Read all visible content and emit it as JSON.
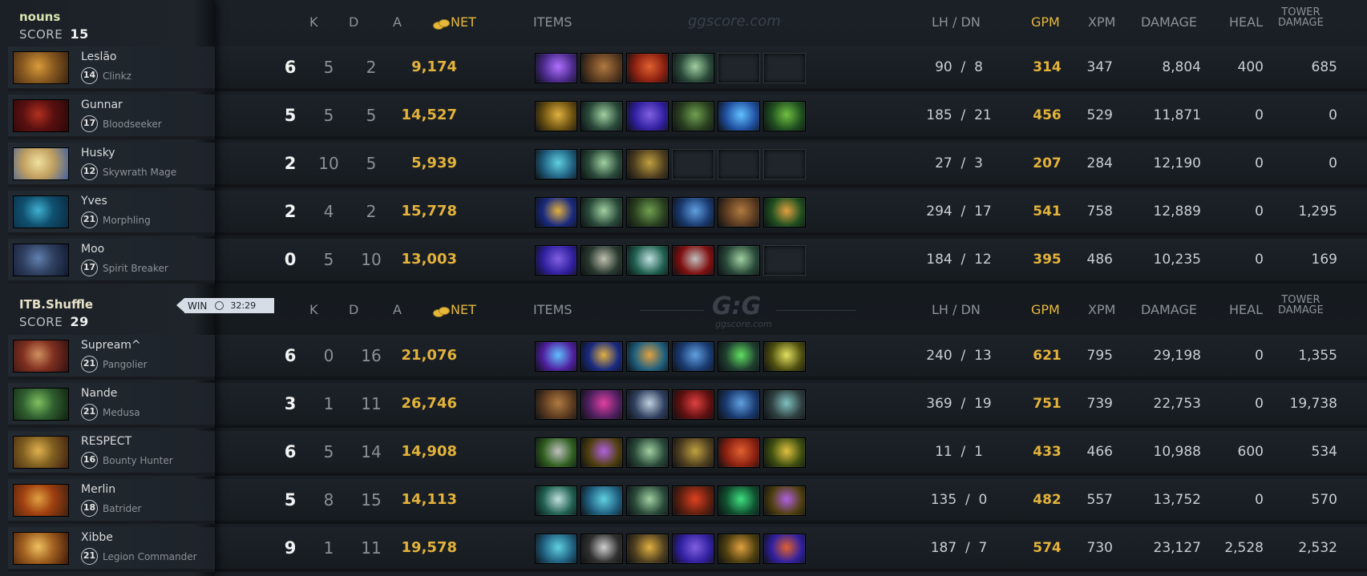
{
  "watermark": "ggscore.com",
  "logo": "G:G",
  "logo_sub": "ggscore.com",
  "headers": {
    "k": "K",
    "d": "D",
    "a": "A",
    "net": "NET",
    "items": "ITEMS",
    "lh_dn": "LH  /  DN",
    "gpm": "GPM",
    "xpm": "XPM",
    "damage": "DAMAGE",
    "heal": "HEAL",
    "tower_1": "TOWER",
    "tower_2": "DAMAGE"
  },
  "result": {
    "label": "WIN",
    "duration": "32:29"
  },
  "teams": [
    {
      "name": "nouns",
      "score_label": "SCORE",
      "score": "15",
      "players": [
        {
          "name": "Leslão",
          "level": "14",
          "hero": "Clinkz",
          "k": "6",
          "d": "5",
          "a": "2",
          "net": "9,174",
          "lh": "90",
          "dn": "8",
          "gpm": "314",
          "xpm": "347",
          "damage": "8,804",
          "heal": "400",
          "tower": "685",
          "portrait": [
            "#8a5a20",
            "#d89b3a",
            "#3a2410"
          ],
          "items": [
            [
              "#4a2a8a",
              "#b070ff"
            ],
            [
              "#5a3a20",
              "#b07a40"
            ],
            [
              "#8a2010",
              "#e06030"
            ],
            [
              "#2a4a3a",
              "#a0d0a0"
            ],
            null,
            null
          ]
        },
        {
          "name": "Gunnar",
          "level": "17",
          "hero": "Bloodseeker",
          "k": "5",
          "d": "5",
          "a": "5",
          "net": "14,527",
          "lh": "185",
          "dn": "21",
          "gpm": "456",
          "xpm": "529",
          "damage": "11,871",
          "heal": "0",
          "tower": "0",
          "portrait": [
            "#5a1010",
            "#b03020",
            "#2a0808"
          ],
          "items": [
            [
              "#6a5010",
              "#e0b040"
            ],
            [
              "#2a4a3a",
              "#a0d0a0"
            ],
            [
              "#3020a0",
              "#8060e0"
            ],
            [
              "#2a4020",
              "#70a050"
            ],
            [
              "#2050a0",
              "#60c0ff"
            ],
            [
              "#205020",
              "#70c040"
            ]
          ]
        },
        {
          "name": "Husky",
          "level": "12",
          "hero": "Skywrath Mage",
          "k": "2",
          "d": "10",
          "a": "5",
          "net": "5,939",
          "lh": "27",
          "dn": "3",
          "gpm": "207",
          "xpm": "284",
          "damage": "12,190",
          "heal": "0",
          "tower": "0",
          "portrait": [
            "#c0a060",
            "#f0e0a0",
            "#4060a0"
          ],
          "items": [
            [
              "#206080",
              "#60d0e0"
            ],
            [
              "#2a4a3a",
              "#a0d0a0"
            ],
            [
              "#504020",
              "#c0a040"
            ],
            null,
            null,
            null
          ]
        },
        {
          "name": "Yves",
          "level": "21",
          "hero": "Morphling",
          "k": "2",
          "d": "4",
          "a": "2",
          "net": "15,778",
          "lh": "294",
          "dn": "17",
          "gpm": "541",
          "xpm": "758",
          "damage": "12,889",
          "heal": "0",
          "tower": "1,295",
          "portrait": [
            "#105070",
            "#40b0d0",
            "#0a2a40"
          ],
          "items": [
            [
              "#1a2a80",
              "#e0b040"
            ],
            [
              "#2a4a3a",
              "#a0d0a0"
            ],
            [
              "#2a4020",
              "#70a050"
            ],
            [
              "#1a3a70",
              "#60a0e0"
            ],
            [
              "#5a3a20",
              "#b07a40"
            ],
            [
              "#205020",
              "#e0a040"
            ]
          ]
        },
        {
          "name": "Moo",
          "level": "17",
          "hero": "Spirit Breaker",
          "k": "0",
          "d": "5",
          "a": "10",
          "net": "13,003",
          "lh": "184",
          "dn": "12",
          "gpm": "395",
          "xpm": "486",
          "damage": "10,235",
          "heal": "0",
          "tower": "169",
          "portrait": [
            "#304060",
            "#6080b0",
            "#101830"
          ],
          "items": [
            [
              "#3020a0",
              "#8060e0"
            ],
            [
              "#2a3a30",
              "#c0c0b0"
            ],
            [
              "#206050",
              "#c0e0e0"
            ],
            [
              "#801010",
              "#c0c0c0"
            ],
            [
              "#2a4a3a",
              "#a0d0a0"
            ],
            null
          ]
        }
      ]
    },
    {
      "name": "ITB.Shuffle",
      "score_label": "SCORE",
      "score": "29",
      "players": [
        {
          "name": "Supream^",
          "level": "21",
          "hero": "Pangolier",
          "k": "6",
          "d": "0",
          "a": "16",
          "net": "21,076",
          "lh": "240",
          "dn": "13",
          "gpm": "621",
          "xpm": "795",
          "damage": "29,198",
          "heal": "0",
          "tower": "1,355",
          "portrait": [
            "#803020",
            "#d09060",
            "#301010"
          ],
          "items": [
            [
              "#5020a0",
              "#60c0ff"
            ],
            [
              "#1a2a80",
              "#e0b040"
            ],
            [
              "#206080",
              "#e0a040"
            ],
            [
              "#1a3a70",
              "#60a0e0"
            ],
            [
              "#204030",
              "#60e060"
            ],
            [
              "#505010",
              "#e0e060"
            ]
          ]
        },
        {
          "name": "Nande",
          "level": "21",
          "hero": "Medusa",
          "k": "3",
          "d": "1",
          "a": "11",
          "net": "26,746",
          "lh": "369",
          "dn": "19",
          "gpm": "751",
          "xpm": "739",
          "damage": "22,753",
          "heal": "0",
          "tower": "19,738",
          "portrait": [
            "#306030",
            "#80c060",
            "#102010"
          ],
          "items": [
            [
              "#5a3a20",
              "#b07a40"
            ],
            [
              "#502060",
              "#e040a0"
            ],
            [
              "#304060",
              "#c0d0e0"
            ],
            [
              "#601010",
              "#e04040"
            ],
            [
              "#1a3a70",
              "#60a0e0"
            ],
            [
              "#304040",
              "#80c0c0"
            ]
          ]
        },
        {
          "name": "RESPECT",
          "level": "16",
          "hero": "Bounty Hunter",
          "k": "6",
          "d": "5",
          "a": "14",
          "net": "14,908",
          "lh": "11",
          "dn": "1",
          "gpm": "433",
          "xpm": "466",
          "damage": "10,988",
          "heal": "600",
          "tower": "534",
          "portrait": [
            "#806020",
            "#e0b050",
            "#402010"
          ],
          "items": [
            [
              "#306020",
              "#c0c0c0"
            ],
            [
              "#504010",
              "#b060e0"
            ],
            [
              "#2a4a3a",
              "#a0d0a0"
            ],
            [
              "#504020",
              "#c0a040"
            ],
            [
              "#8a2010",
              "#e06030"
            ],
            [
              "#405010",
              "#e0c040"
            ]
          ]
        },
        {
          "name": "Merlin",
          "level": "18",
          "hero": "Batrider",
          "k": "5",
          "d": "8",
          "a": "15",
          "net": "14,113",
          "lh": "135",
          "dn": "0",
          "gpm": "482",
          "xpm": "557",
          "damage": "13,752",
          "heal": "0",
          "tower": "570",
          "portrait": [
            "#a04010",
            "#e0a040",
            "#402010"
          ],
          "items": [
            [
              "#206050",
              "#c0e0e0"
            ],
            [
              "#206080",
              "#60d0e0"
            ],
            [
              "#2a4a3a",
              "#a0d0a0"
            ],
            [
              "#602010",
              "#e04020"
            ],
            [
              "#105030",
              "#40e080"
            ],
            [
              "#504010",
              "#b060e0"
            ]
          ]
        },
        {
          "name": "Xibbe",
          "level": "21",
          "hero": "Legion Commander",
          "k": "9",
          "d": "1",
          "a": "11",
          "net": "19,578",
          "lh": "187",
          "dn": "7",
          "gpm": "574",
          "xpm": "730",
          "damage": "23,127",
          "heal": "2,528",
          "tower": "2,532",
          "portrait": [
            "#a06020",
            "#f0c060",
            "#401808"
          ],
          "items": [
            [
              "#206080",
              "#60d0e0"
            ],
            [
              "#303030",
              "#d0d0d0"
            ],
            [
              "#504020",
              "#e0b040"
            ],
            [
              "#3020a0",
              "#8060e0"
            ],
            [
              "#504010",
              "#e0a040"
            ],
            [
              "#3020a0",
              "#e06030"
            ]
          ]
        }
      ]
    }
  ]
}
